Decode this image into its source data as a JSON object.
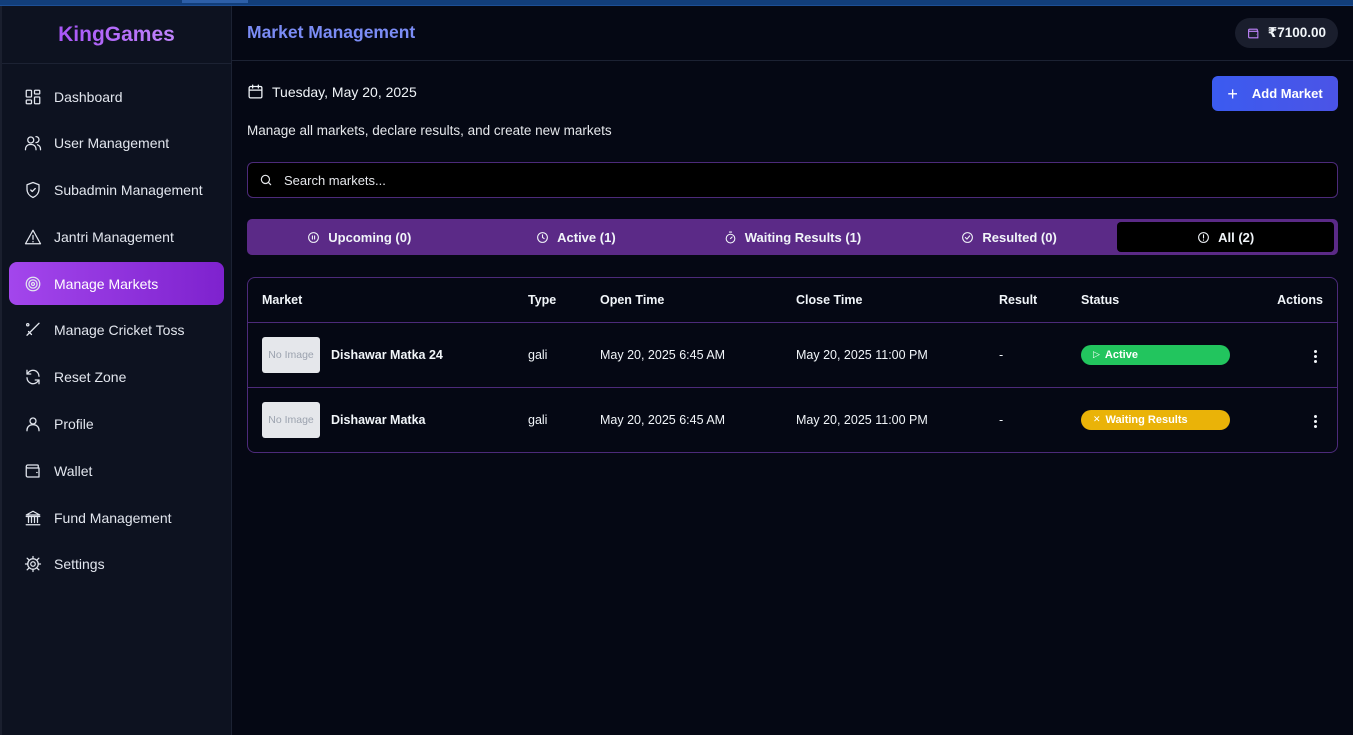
{
  "brand": "KingGames",
  "sidebar": {
    "items": [
      {
        "label": "Dashboard",
        "icon": "dashboard-icon"
      },
      {
        "label": "User Management",
        "icon": "users-icon"
      },
      {
        "label": "Subadmin Management",
        "icon": "shield-icon"
      },
      {
        "label": "Jantri Management",
        "icon": "warning-icon"
      },
      {
        "label": "Manage Markets",
        "icon": "target-icon",
        "active": true
      },
      {
        "label": "Manage Cricket Toss",
        "icon": "cricket-bat-icon"
      },
      {
        "label": "Reset Zone",
        "icon": "refresh-icon"
      },
      {
        "label": "Profile",
        "icon": "user-icon"
      },
      {
        "label": "Wallet",
        "icon": "wallet-icon"
      },
      {
        "label": "Fund Management",
        "icon": "bank-icon"
      },
      {
        "label": "Settings",
        "icon": "gear-icon"
      }
    ]
  },
  "header": {
    "title": "Market Management",
    "balance": "₹7100.00"
  },
  "main": {
    "date": "Tuesday, May 20, 2025",
    "subtitle": "Manage all markets, declare results, and create new markets",
    "add_button": "Add Market",
    "search_placeholder": "Search markets...",
    "tabs": [
      {
        "label": "Upcoming (0)",
        "icon": "pause-circle-icon"
      },
      {
        "label": "Active (1)",
        "icon": "clock-icon"
      },
      {
        "label": "Waiting Results (1)",
        "icon": "timer-icon"
      },
      {
        "label": "Resulted (0)",
        "icon": "check-circle-icon"
      },
      {
        "label": "All (2)",
        "icon": "alert-circle-icon",
        "selected": true
      }
    ],
    "table": {
      "columns": [
        "Market",
        "Type",
        "Open Time",
        "Close Time",
        "Result",
        "Status",
        "Actions"
      ],
      "rows": [
        {
          "image": "No Image",
          "name": "Dishawar Matka 24",
          "type": "gali",
          "open": "May 20, 2025 6:45 AM",
          "close": "May 20, 2025 11:00 PM",
          "result": "-",
          "status": "Active",
          "status_icon": "▷"
        },
        {
          "image": "No Image",
          "name": "Dishawar Matka",
          "type": "gali",
          "open": "May 20, 2025 6:45 AM",
          "close": "May 20, 2025 11:00 PM",
          "result": "-",
          "status": "Waiting Results",
          "status_icon": "✕"
        }
      ]
    }
  },
  "colors": {
    "accent": "#a855f7",
    "active_nav": "#9333ea",
    "tab_bar": "#5b2a87",
    "status_active": "#22c55e",
    "status_waiting": "#eab308",
    "add_button": "#3b5bf0"
  }
}
